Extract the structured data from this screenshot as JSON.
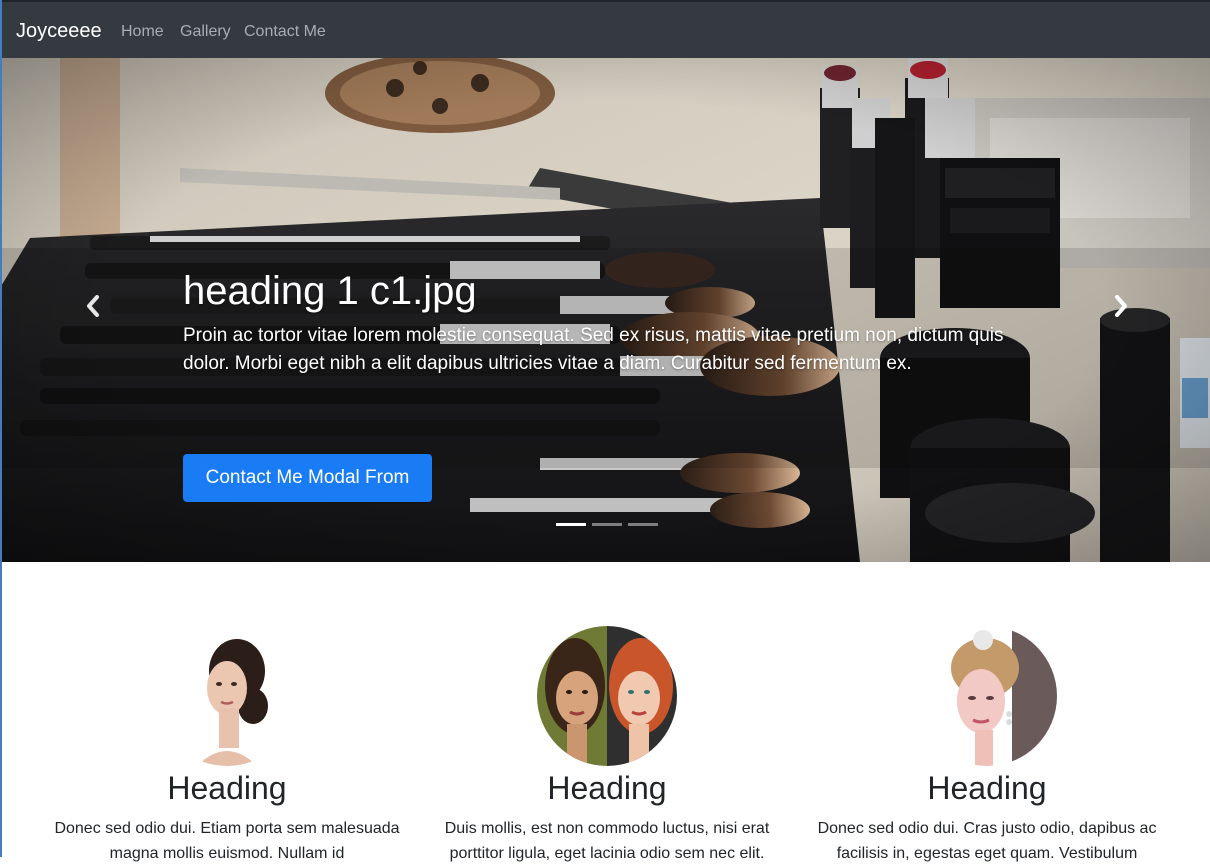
{
  "navbar": {
    "brand": "Joyceeee",
    "links": [
      "Home",
      "Gallery",
      "Contact Me"
    ]
  },
  "carousel": {
    "caption_title": "heading 1 c1.jpg",
    "caption_text": "Proin ac tortor vitae lorem molestie consequat. Sed ex risus, mattis vitae pretium non, dictum quis dolor. Morbi eget nibh a elit dapibus ultricies vitae a diam. Curabitur sed fermentum ex.",
    "button_label": "Contact Me Modal From",
    "slide_count": 3,
    "active_slide": 1,
    "prev_icon": "chevron-left-icon",
    "next_icon": "chevron-right-icon"
  },
  "features": [
    {
      "heading": "Heading",
      "text": "Donec sed odio dui. Etiam porta sem malesuada magna mollis euismod. Nullam id"
    },
    {
      "heading": "Heading",
      "text": "Duis mollis, est non commodo luctus, nisi erat porttitor ligula, eget lacinia odio sem nec elit."
    },
    {
      "heading": "Heading",
      "text": "Donec sed odio dui. Cras justo odio, dapibus ac facilisis in, egestas eget quam. Vestibulum"
    }
  ],
  "colors": {
    "navbar_bg": "#343a40",
    "primary_button": "#1a7cf5",
    "nav_link": "#a8adb2"
  }
}
